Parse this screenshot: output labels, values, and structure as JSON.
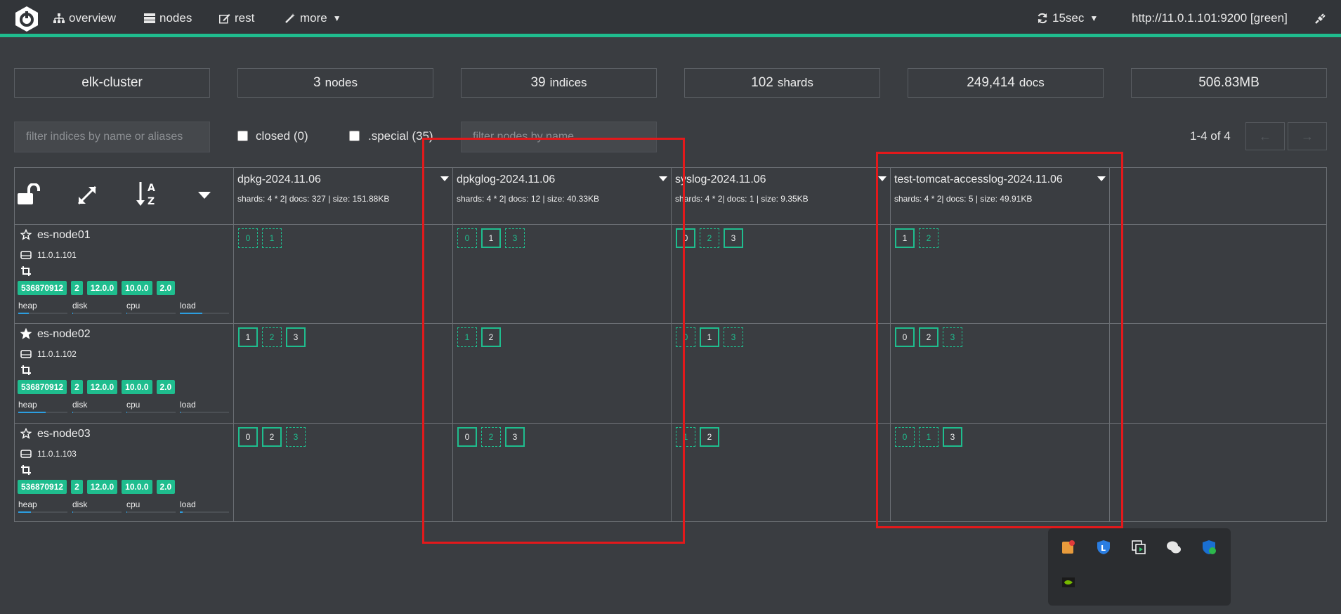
{
  "nav": {
    "overview": "overview",
    "nodes": "nodes",
    "rest": "rest",
    "more": "more",
    "refresh": "15sec",
    "cluster_url": "http://11.0.1.101:9200 [green]"
  },
  "stats": {
    "cluster_name": "elk-cluster",
    "nodes_value": "3",
    "nodes_unit": "nodes",
    "indices_value": "39",
    "indices_unit": "indices",
    "shards_value": "102",
    "shards_unit": "shards",
    "docs_value": "249,414",
    "docs_unit": "docs",
    "size": "506.83MB"
  },
  "filters": {
    "indices_placeholder": "filter indices by name or aliases",
    "closed_label": "closed (0)",
    "special_label": ".special (35)",
    "nodes_placeholder": "filter nodes by name",
    "pager": "1-4 of 4",
    "prev": "←",
    "next": "→"
  },
  "indices": [
    {
      "name": "dpkg-2024.11.06",
      "info": "shards: 4 * 2| docs: 327 | size: 151.88KB"
    },
    {
      "name": "dpkglog-2024.11.06",
      "info": "shards: 4 * 2| docs: 12 | size: 40.33KB"
    },
    {
      "name": "syslog-2024.11.06",
      "info": "shards: 4 * 2| docs: 1 | size: 9.35KB"
    },
    {
      "name": "test-tomcat-accesslog-2024.11.06",
      "info": "shards: 4 * 2| docs: 5 | size: 49.91KB"
    }
  ],
  "nodes": [
    {
      "name": "es-node01",
      "ip": "11.0.1.101",
      "master": false,
      "badges": [
        "536870912",
        "2",
        "12.0.0",
        "10.0.0",
        "2.0"
      ],
      "metrics": {
        "heap": "heap",
        "disk": "disk",
        "cpu": "cpu",
        "load": "load"
      },
      "levels": {
        "heap": 0.22,
        "disk": 0.02,
        "cpu": 0.02,
        "load": 0.45
      }
    },
    {
      "name": "es-node02",
      "ip": "11.0.1.102",
      "master": true,
      "badges": [
        "536870912",
        "2",
        "12.0.0",
        "10.0.0",
        "2.0"
      ],
      "metrics": {
        "heap": "heap",
        "disk": "disk",
        "cpu": "cpu",
        "load": "load"
      },
      "levels": {
        "heap": 0.55,
        "disk": 0.02,
        "cpu": 0.02,
        "load": 0.02
      }
    },
    {
      "name": "es-node03",
      "ip": "11.0.1.103",
      "master": false,
      "badges": [
        "536870912",
        "2",
        "12.0.0",
        "10.0.0",
        "2.0"
      ],
      "metrics": {
        "heap": "heap",
        "disk": "disk",
        "cpu": "cpu",
        "load": "load"
      },
      "levels": {
        "heap": 0.25,
        "disk": 0.02,
        "cpu": 0.02,
        "load": 0.06
      }
    }
  ],
  "shard_map": [
    [
      [
        {
          "n": "0",
          "p": false
        },
        {
          "n": "1",
          "p": false
        }
      ],
      [
        {
          "n": "0",
          "p": false
        },
        {
          "n": "1",
          "p": true
        },
        {
          "n": "3",
          "p": false
        }
      ],
      [
        {
          "n": "0",
          "p": true
        },
        {
          "n": "2",
          "p": false
        },
        {
          "n": "3",
          "p": true
        }
      ],
      [
        {
          "n": "1",
          "p": true
        },
        {
          "n": "2",
          "p": false
        }
      ]
    ],
    [
      [
        {
          "n": "1",
          "p": true
        },
        {
          "n": "2",
          "p": false
        },
        {
          "n": "3",
          "p": true
        }
      ],
      [
        {
          "n": "1",
          "p": false
        },
        {
          "n": "2",
          "p": true
        }
      ],
      [
        {
          "n": "0",
          "p": false
        },
        {
          "n": "1",
          "p": true
        },
        {
          "n": "3",
          "p": false
        }
      ],
      [
        {
          "n": "0",
          "p": true
        },
        {
          "n": "2",
          "p": true
        },
        {
          "n": "3",
          "p": false
        }
      ]
    ],
    [
      [
        {
          "n": "0",
          "p": true
        },
        {
          "n": "2",
          "p": true
        },
        {
          "n": "3",
          "p": false
        }
      ],
      [
        {
          "n": "0",
          "p": true
        },
        {
          "n": "2",
          "p": false
        },
        {
          "n": "3",
          "p": true
        }
      ],
      [
        {
          "n": "1",
          "p": false
        },
        {
          "n": "2",
          "p": true
        }
      ],
      [
        {
          "n": "0",
          "p": false
        },
        {
          "n": "1",
          "p": false
        },
        {
          "n": "3",
          "p": true
        }
      ]
    ]
  ],
  "colors": {
    "accent": "#1fbd8e",
    "highlight": "#e3191b",
    "bar": "#2c9ee0"
  },
  "tray_icons": [
    "notification-app-icon",
    "lenovo-shield-icon",
    "screen-switch-icon",
    "wechat-icon",
    "defender-icon",
    "nvidia-icon"
  ]
}
